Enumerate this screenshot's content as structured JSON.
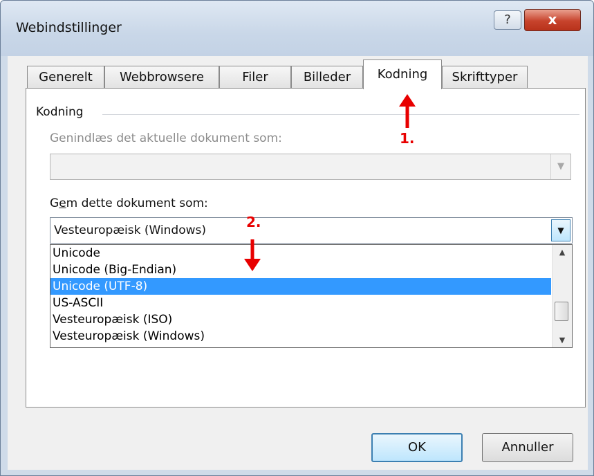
{
  "window": {
    "title": "Webindstillinger",
    "help_label": "?",
    "close_label": "x"
  },
  "tabs": [
    {
      "label": "Generelt"
    },
    {
      "label": "Webbrowsere"
    },
    {
      "label": "Filer"
    },
    {
      "label": "Billeder"
    },
    {
      "label": "Kodning"
    },
    {
      "label": "Skrifttyper"
    }
  ],
  "active_tab": "Kodning",
  "encoding": {
    "group_label": "Kodning",
    "reload_label": "Genindlæs det aktuelle dokument som:",
    "reload_value": "",
    "save_label_prefix": "G",
    "save_label_accel": "e",
    "save_label_suffix": "m dette dokument som:",
    "save_value": "Vesteuropæisk (Windows)",
    "options": [
      {
        "label": "Unicode"
      },
      {
        "label": "Unicode (Big-Endian)"
      },
      {
        "label": "Unicode (UTF-8)"
      },
      {
        "label": "US-ASCII"
      },
      {
        "label": "Vesteuropæisk (ISO)"
      },
      {
        "label": "Vesteuropæisk (Windows)"
      }
    ],
    "highlighted_option": "Unicode (UTF-8)"
  },
  "buttons": {
    "ok": "OK",
    "cancel": "Annuller"
  },
  "annotations": {
    "step1": "1.",
    "step2": "2.",
    "color": "#e80000"
  }
}
